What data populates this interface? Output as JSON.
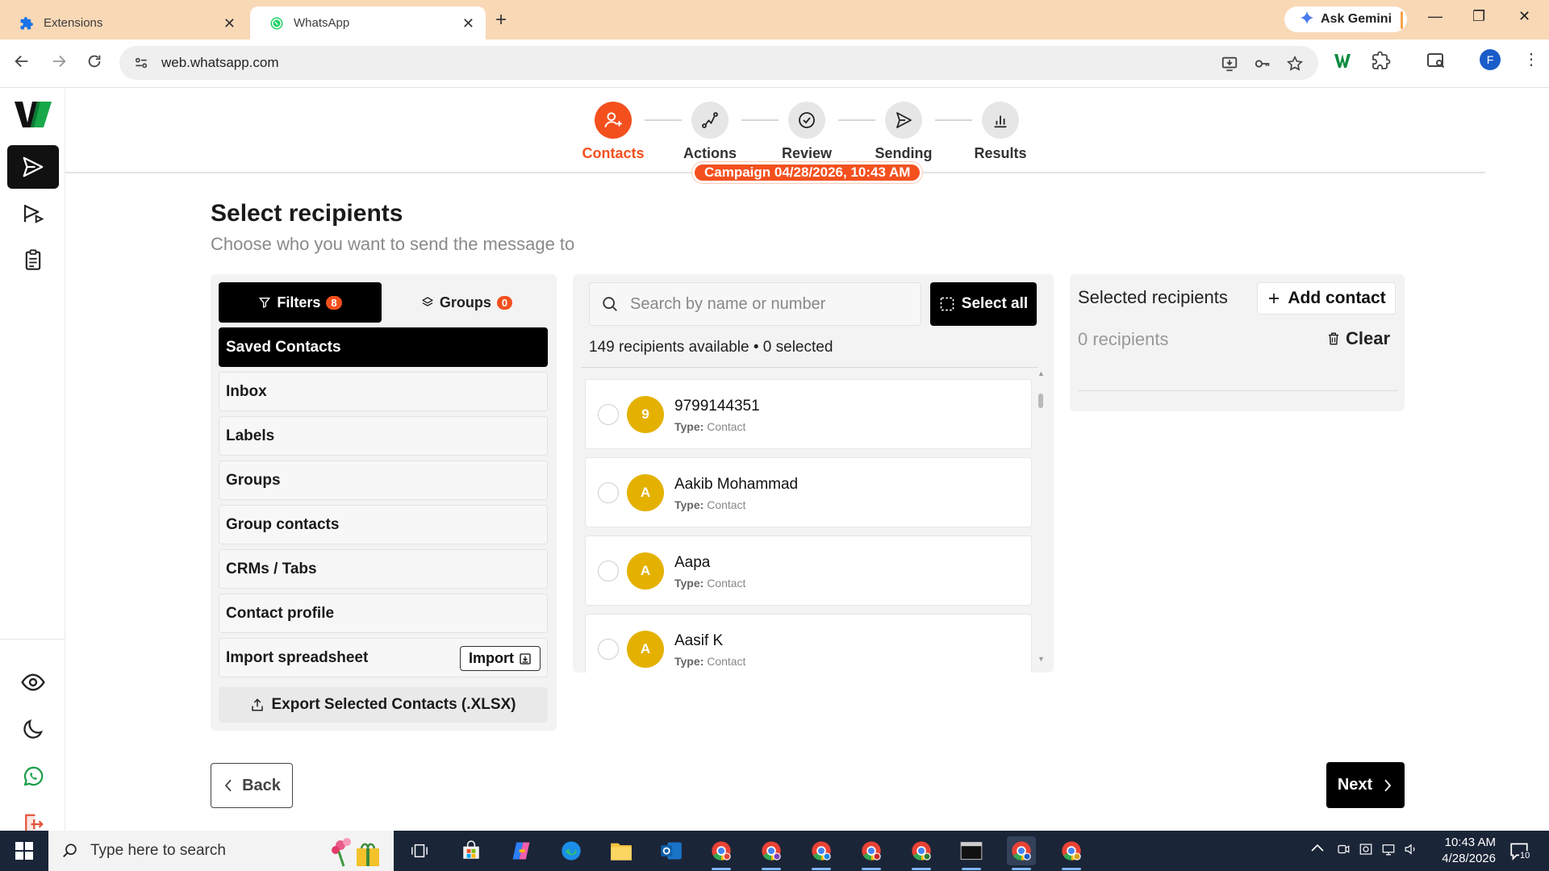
{
  "browser": {
    "tabs": [
      {
        "title": "Extensions",
        "active": false
      },
      {
        "title": "WhatsApp",
        "active": true
      }
    ],
    "ask_gemini": "Ask Gemini",
    "url": "web.whatsapp.com",
    "profile_initial": "F"
  },
  "stepper": {
    "steps": [
      {
        "label": "Contacts",
        "active": true,
        "icon": "user-plus-icon"
      },
      {
        "label": "Actions",
        "active": false,
        "icon": "route-icon"
      },
      {
        "label": "Review",
        "active": false,
        "icon": "check-circle-icon"
      },
      {
        "label": "Sending",
        "active": false,
        "icon": "send-icon"
      },
      {
        "label": "Results",
        "active": false,
        "icon": "bar-chart-icon"
      }
    ],
    "campaign": "Campaign 04/28/2026, 10:43 AM"
  },
  "page": {
    "title": "Select recipients",
    "subtitle": "Choose who you want to send the message to"
  },
  "filters": {
    "filters_tab": "Filters",
    "filters_count": "8",
    "groups_tab": "Groups",
    "groups_count": "0",
    "items": [
      {
        "label": "Saved Contacts",
        "active": true
      },
      {
        "label": "Inbox",
        "active": false
      },
      {
        "label": "Labels",
        "active": false
      },
      {
        "label": "Groups",
        "active": false
      },
      {
        "label": "Group contacts",
        "active": false
      },
      {
        "label": "CRMs / Tabs",
        "active": false
      },
      {
        "label": "Contact profile",
        "active": false
      },
      {
        "label": "Import spreadsheet",
        "active": false
      }
    ],
    "import_label": "Import",
    "export_label": "Export Selected Contacts (.XLSX)"
  },
  "contacts": {
    "search_placeholder": "Search by name or number",
    "select_all": "Select all",
    "available_text": "149 recipients available • 0 selected",
    "type_label": "Type:",
    "list": [
      {
        "initial": "9",
        "name": "9799144351",
        "type": "Contact"
      },
      {
        "initial": "A",
        "name": "Aakib Mohammad",
        "type": "Contact"
      },
      {
        "initial": "A",
        "name": "Aapa",
        "type": "Contact"
      },
      {
        "initial": "A",
        "name": "Aasif K",
        "type": "Contact"
      }
    ]
  },
  "selected": {
    "title": "Selected recipients",
    "add_contact": "Add contact",
    "count_text": "0 recipients",
    "clear": "Clear"
  },
  "footer": {
    "back": "Back",
    "next": "Next"
  },
  "taskbar": {
    "search_placeholder": "Type here to search",
    "time": "10:43 AM",
    "date": "4/28/2026",
    "notification_count": "10"
  },
  "colors": {
    "accent": "#f4501e",
    "avatar": "#e4b100",
    "primary_button": "#000000",
    "panel_bg": "#f3f3f3",
    "tabstrip": "#f9d8b6",
    "taskbar": "#1b2538"
  }
}
